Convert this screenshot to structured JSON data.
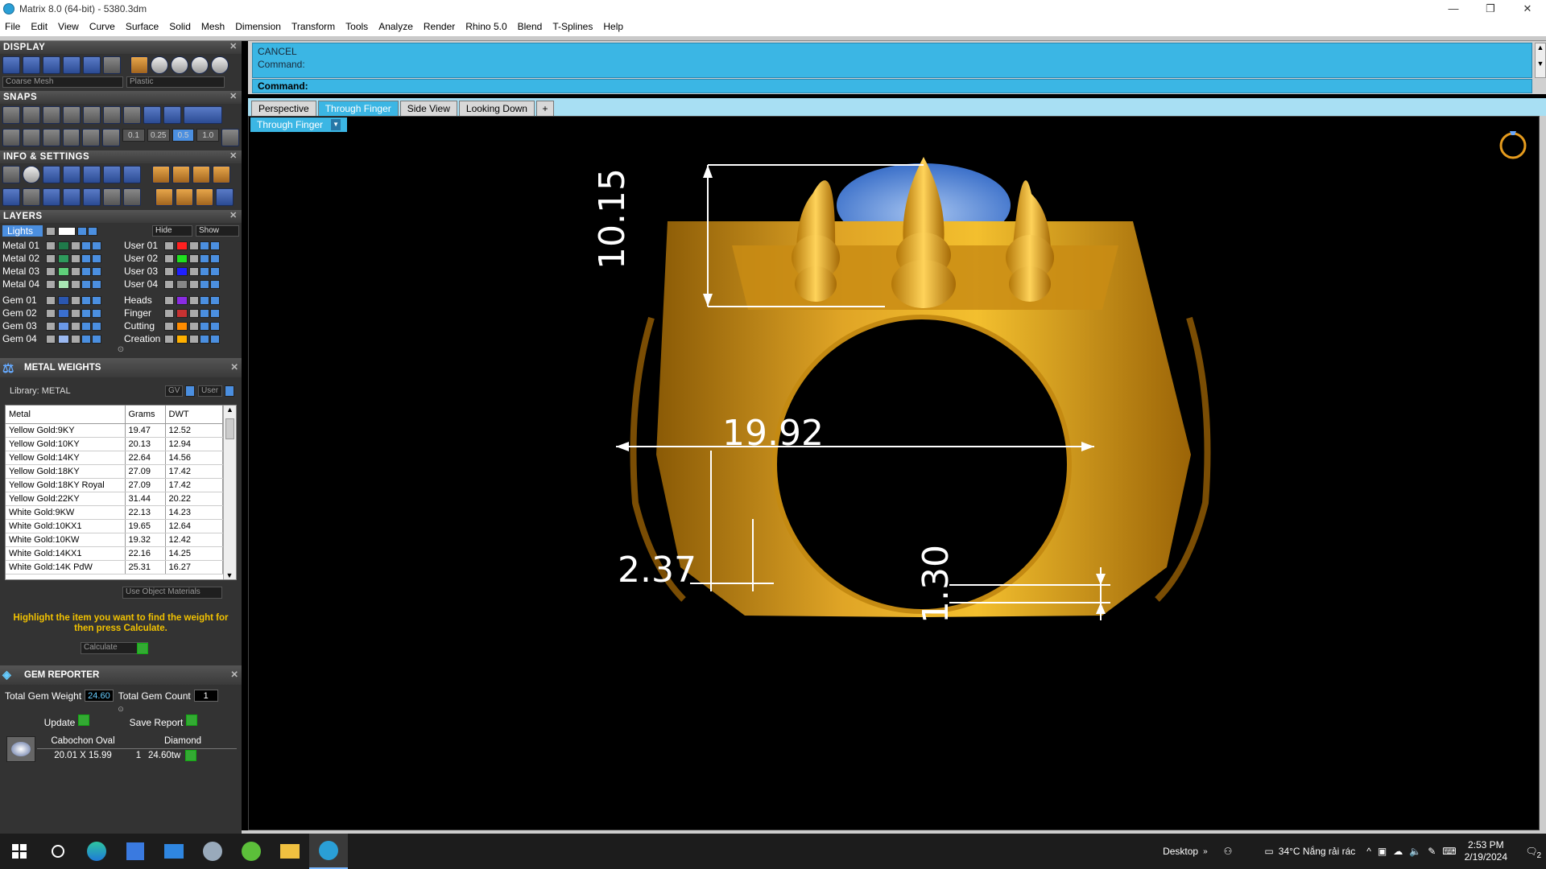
{
  "window": {
    "title": "Matrix 8.0 (64-bit) - 5380.3dm",
    "minimize": "—",
    "maximize": "❐",
    "close": "✕"
  },
  "menu": [
    "File",
    "Edit",
    "View",
    "Curve",
    "Surface",
    "Solid",
    "Mesh",
    "Dimension",
    "Transform",
    "Tools",
    "Analyze",
    "Render",
    "Rhino 5.0",
    "Blend",
    "T-Splines",
    "Help"
  ],
  "display": {
    "title": "DISPLAY",
    "mesh_select": "Coarse Mesh",
    "material_select": "Plastic"
  },
  "snaps": {
    "title": "SNAPS",
    "values": [
      "0.1",
      "0.25",
      "0.5",
      "1.0"
    ]
  },
  "info": {
    "title": "INFO & SETTINGS"
  },
  "layers": {
    "title": "LAYERS",
    "lights": "Lights",
    "hide": "Hide",
    "show": "Show",
    "left": [
      {
        "name": "Metal 01",
        "color": "#1f7a4a"
      },
      {
        "name": "Metal 02",
        "color": "#2e9a5c"
      },
      {
        "name": "Metal 03",
        "color": "#5fcf7a"
      },
      {
        "name": "Metal 04",
        "color": "#a8e6b3"
      },
      {
        "name": "Gem 01",
        "color": "#2a56b0"
      },
      {
        "name": "Gem 02",
        "color": "#3a6fd0"
      },
      {
        "name": "Gem 03",
        "color": "#6a98e8"
      },
      {
        "name": "Gem 04",
        "color": "#9ab8f0"
      }
    ],
    "right": [
      {
        "name": "User 01",
        "color": "#ff2020"
      },
      {
        "name": "User 02",
        "color": "#20e020"
      },
      {
        "name": "User 03",
        "color": "#2020ff"
      },
      {
        "name": "User 04",
        "color": "#888888"
      },
      {
        "name": "Heads",
        "color": "#8a2be2"
      },
      {
        "name": "Finger",
        "color": "#c83232"
      },
      {
        "name": "Cutting",
        "color": "#ff8c00"
      },
      {
        "name": "Creation",
        "color": "#ffb000"
      }
    ]
  },
  "metal_weights": {
    "title": "METAL WEIGHTS",
    "library": "Library: METAL",
    "gv": "GV",
    "user": "User",
    "columns": [
      "Metal",
      "Grams",
      "DWT"
    ],
    "rows": [
      [
        "Yellow Gold:9KY",
        "19.47",
        "12.52"
      ],
      [
        "Yellow Gold:10KY",
        "20.13",
        "12.94"
      ],
      [
        "Yellow Gold:14KY",
        "22.64",
        "14.56"
      ],
      [
        "Yellow Gold:18KY",
        "27.09",
        "17.42"
      ],
      [
        "Yellow Gold:18KY Royal",
        "27.09",
        "17.42"
      ],
      [
        "Yellow Gold:22KY",
        "31.44",
        "20.22"
      ],
      [
        "White Gold:9KW",
        "22.13",
        "14.23"
      ],
      [
        "White Gold:10KX1",
        "19.65",
        "12.64"
      ],
      [
        "White Gold:10KW",
        "19.32",
        "12.42"
      ],
      [
        "White Gold:14KX1",
        "22.16",
        "14.25"
      ],
      [
        "White Gold:14K PdW",
        "25.31",
        "16.27"
      ]
    ],
    "use_object_materials": "Use Object Materials",
    "hint": "Highlight the item you want to find the weight for then press Calculate.",
    "calculate": "Calculate"
  },
  "gem_reporter": {
    "title": "GEM REPORTER",
    "total_weight_label": "Total Gem Weight",
    "total_weight": "24.60",
    "total_count_label": "Total Gem Count",
    "total_count": "1",
    "update": "Update",
    "save_report": "Save Report",
    "gem": {
      "shape": "Cabochon Oval",
      "size": "20.01 X 15.99",
      "type": "Diamond",
      "count": "1",
      "weight": "24.60tw"
    }
  },
  "command": {
    "line1": "CANCEL",
    "line2": "Command:",
    "prompt": "Command:"
  },
  "tabs": [
    "Perspective",
    "Through Finger",
    "Side View",
    "Looking Down",
    "+"
  ],
  "active_tab": "Through Finger",
  "viewport": {
    "label": "Through Finger",
    "dimensions": {
      "height": "10.15",
      "diameter": "19.92",
      "shank_width": "2.37",
      "bottom": "1.30"
    }
  },
  "taskbar": {
    "desktop": "Desktop",
    "weather": "34°C  Nắng rải rác",
    "time": "2:53 PM",
    "date": "2/19/2024",
    "notifications": "2"
  }
}
